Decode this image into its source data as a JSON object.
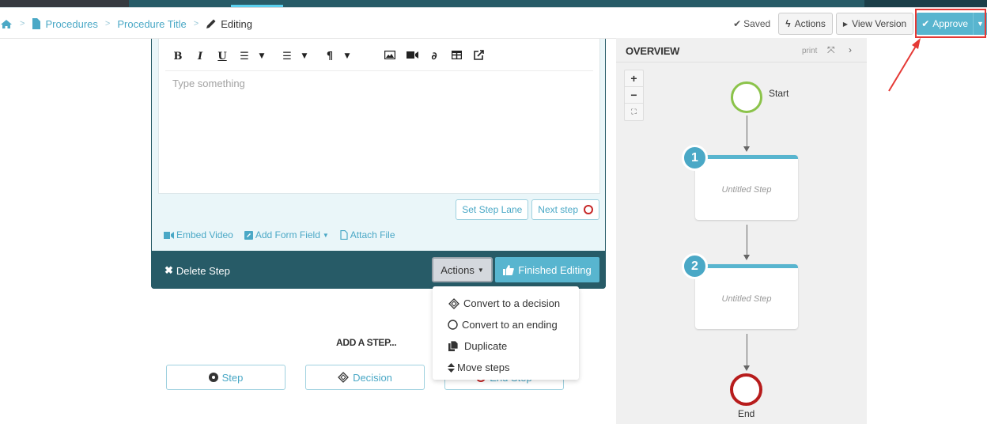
{
  "breadcrumb": {
    "home_icon": "home-icon",
    "items": [
      {
        "label": "Procedures",
        "icon": "file-icon"
      },
      {
        "label": "Procedure Title"
      }
    ],
    "current": {
      "label": "Editing",
      "icon": "pencil-icon"
    }
  },
  "header": {
    "saved_label": "Saved",
    "actions_label": "Actions",
    "view_version_label": "View Version",
    "approve_label": "Approve"
  },
  "editor": {
    "toolbar": [
      "bold",
      "italic",
      "underline",
      "ordered-list",
      "unordered-list",
      "paragraph",
      "image",
      "video",
      "link",
      "table",
      "external-link"
    ],
    "placeholder": "Type something",
    "set_step_lane_label": "Set Step Lane",
    "next_step_label": "Next step",
    "embed_video_label": "Embed Video",
    "add_form_field_label": "Add Form Field",
    "attach_file_label": "Attach File",
    "delete_step_label": "Delete Step",
    "actions_label": "Actions",
    "finished_editing_label": "Finished Editing"
  },
  "actions_menu": {
    "items": [
      {
        "label": "Convert to a decision",
        "icon": "diamond-icon"
      },
      {
        "label": "Convert to an ending",
        "icon": "circle-icon"
      },
      {
        "label": "Duplicate",
        "icon": "copy-icon"
      },
      {
        "label": "Move steps",
        "icon": "sort-icon"
      }
    ]
  },
  "add_step": {
    "title": "ADD A STEP...",
    "buttons": [
      {
        "label": "Step",
        "icon": "dot-circle-icon"
      },
      {
        "label": "Decision",
        "icon": "diamond-icon"
      },
      {
        "label": "End Step",
        "icon": "circle-icon"
      }
    ]
  },
  "overview": {
    "title": "OVERVIEW",
    "print_label": "print",
    "zoom_in": "+",
    "zoom_out": "−",
    "start_label": "Start",
    "steps": [
      {
        "number": "1",
        "title": "Untitled Step"
      },
      {
        "number": "2",
        "title": "Untitled Step"
      }
    ],
    "end_label": "End"
  },
  "colors": {
    "accent": "#58b5cf",
    "dark_teal": "#275b67",
    "start": "#8bc34a",
    "end": "#b71c1c",
    "highlight": "#e53935"
  }
}
